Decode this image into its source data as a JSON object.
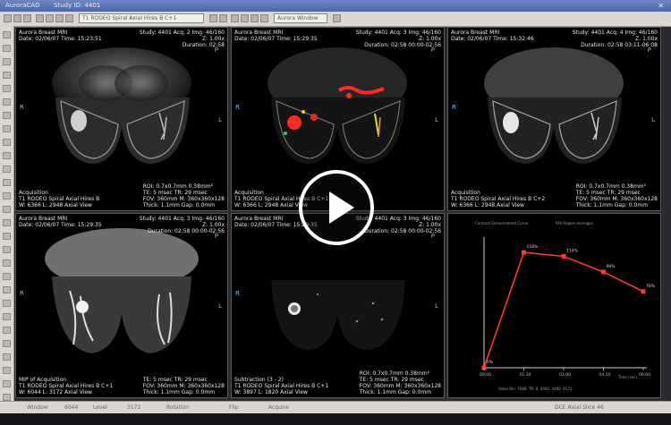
{
  "window": {
    "title": "AuroraCAD",
    "study_label": "Study ID: 4401",
    "series_dropdown": "T1 RODEO Spiral Axial Hires B C+1",
    "toolbar_text": "Aurora Window"
  },
  "viewports": [
    {
      "name": "viewport-1",
      "tl": [
        "Aurora Breast MRI",
        "Date: 02/06/07 Time: 15:23:51"
      ],
      "tr": [
        "Study: 4401 Acq: 2 Img: 46/160",
        "Z: 1.00x",
        "Duration: 02:58"
      ],
      "bl": [
        "Acquisition",
        "T1 RODEO Spiral Axial Hires B",
        "W: 6366 L: 2948 Axial View"
      ],
      "br": [
        "ROI: 0.7x0.7mm 0.38mm²",
        "TE: 5 msec TR: 29 msec",
        "FOV: 360mm M: 360x360x128",
        "Thick: 1.1mm Gap: 0.0mm"
      ],
      "markers": [
        "P",
        "R",
        "L"
      ]
    },
    {
      "name": "viewport-2",
      "tl": [
        "Aurora Breast MRI",
        "Date: 02/06/07 Time: 15:29:35"
      ],
      "tr": [
        "Study: 4401 Acq: 3 Img: 46/160",
        "Z: 1.00x",
        "Duration: 02:58 00:00-02:56"
      ],
      "bl": [
        "Acquisition",
        "T1 RODEO Spiral Axial Hires B C+1",
        "W: 6366 L: 2948 Axial View"
      ],
      "br": [],
      "markers": [
        "P",
        "R",
        "L"
      ]
    },
    {
      "name": "viewport-3",
      "tl": [
        "Aurora Breast MRI",
        "Date: 02/06/07 Time: 15:32:46"
      ],
      "tr": [
        "Study: 4401 Acq: 4 Img: 46/160",
        "Z: 1.00x",
        "Duration: 02:58 03:11-06:08"
      ],
      "bl": [
        "Acquisition",
        "T1 RODEO Spiral Axial Hires B C+2",
        "W: 6366 L: 2948 Axial View"
      ],
      "br": [
        "ROI: 0.7x0.7mm 0.38mm²",
        "TE: 5 msec TR: 29 msec",
        "FOV: 360mm M: 360x360x128",
        "Thick: 1.1mm Gap: 0.0mm"
      ],
      "markers": [
        "P",
        "R",
        "L"
      ]
    },
    {
      "name": "viewport-4",
      "tl": [
        "Aurora Breast MRI",
        "Date: 02/06/07 Time: 15:29:35"
      ],
      "tr": [
        "Study: 4401 Acq: 3 Img: 46/160",
        "Z: 1.00x",
        "Duration: 02:58 00:00-02:56"
      ],
      "bl": [
        "MIP of Acquisition",
        "T1 RODEO Spiral Axial Hires B C+1",
        "W: 6044 L: 3172 Axial View"
      ],
      "br": [
        "TE: 5 msec TR: 29 msec",
        "FOV: 360mm M: 360x360x128",
        "Thick: 1.1mm Gap: 0.0mm"
      ],
      "markers": [
        "P",
        "R",
        "L"
      ]
    },
    {
      "name": "viewport-5",
      "tl": [
        "Aurora Breast MRI",
        "Date: 02/06/07 Time: 15:29:35"
      ],
      "tr": [
        "Study: 4401 Acq: 3 Img: 46/160",
        "Z: 1.00x",
        "Duration: 02:58 00:00-02:56"
      ],
      "bl": [
        "Subtraction (3 - 2)",
        "T1 RODEO Spiral Axial Hires B C+1",
        "W: 3897 L: 1820 Axial View"
      ],
      "br": [
        "ROI: 0.7x0.7mm 0.38mm²",
        "TE: 5 msec TR: 29 msec",
        "FOV: 360mm M: 360x360x128",
        "Thick: 1.1mm Gap: 0.0mm"
      ],
      "markers": [
        "P",
        "R",
        "L"
      ]
    }
  ],
  "curve_panel": {
    "title": "Contrast Enhancement Curve",
    "subtitle": "ROI Region Averages",
    "xlabel": "Time (sec)",
    "footer": "Value Bin: 7088, TR: 0, 4400, 4480, 9172"
  },
  "chart_data": {
    "type": "line",
    "x": [
      0,
      1,
      2,
      3,
      4
    ],
    "categories": [
      "00:00",
      "01:30",
      "03:00",
      "04:30",
      "06:00"
    ],
    "values": [
      0,
      118,
      114,
      98,
      78
    ],
    "point_labels": [
      "0%",
      "118%",
      "114%",
      "98%",
      "78%"
    ],
    "ylim": [
      0,
      130
    ],
    "color": "#ff3b30",
    "grid": false,
    "legend": "none"
  },
  "statusbar": {
    "window_label": "Window",
    "window_value": "6044",
    "level_label": "Level",
    "level_value": "3172",
    "rotation_label": "Rotation",
    "flip_label": "Flip",
    "scroll_label": "Acquire",
    "series_status": "DCE Axial Slice 46"
  }
}
